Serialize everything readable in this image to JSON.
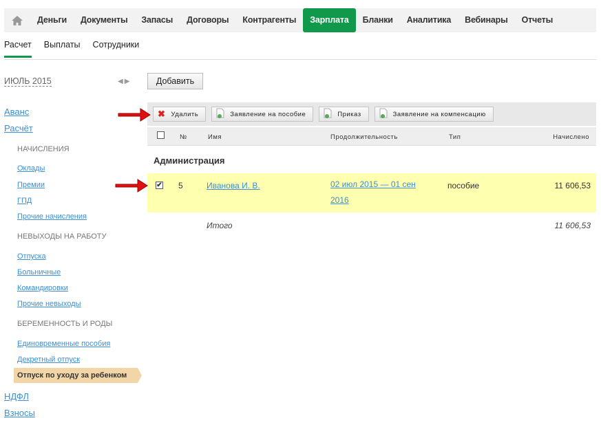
{
  "topnav": {
    "items": [
      "Деньги",
      "Документы",
      "Запасы",
      "Договоры",
      "Контрагенты",
      "Зарплата",
      "Бланки",
      "Аналитика",
      "Вебинары",
      "Отчеты"
    ],
    "active": "Зарплата",
    "accent": "#10994a"
  },
  "subnav": {
    "items": [
      "Расчет",
      "Выплаты",
      "Сотрудники"
    ]
  },
  "period": "ИЮЛЬ 2015",
  "add_label": "Добавить",
  "sidebar": {
    "avans": "Аванс",
    "raschet": "Расчёт",
    "h1": "НАЧИСЛЕНИЯ",
    "okl": "Оклады",
    "prem": "Премии",
    "gpd": "ГПД",
    "proch": "Прочие начисления",
    "h2": "НЕВЫХОДЫ НА РАБОТУ",
    "otp": "Отпуска",
    "bol": "Больничные",
    "kom": "Командировки",
    "prnev": "Прочие невыходы",
    "h3": "БЕРЕМЕННОСТЬ И РОДЫ",
    "edin": "Единовременные пособия",
    "dekr": "Декретный отпуск",
    "active": "Отпуск по уходу за ребенком",
    "ndfl": "НДФЛ",
    "vznosy": "Взносы"
  },
  "toolbar": {
    "delete": "Удалить",
    "benefit": "Заявление на пособие",
    "order": "Приказ",
    "compensation": "Заявление на компенсацию"
  },
  "table": {
    "headers": {
      "num": "№",
      "name": "Имя",
      "duration": "Продолжительность",
      "type": "Тип",
      "accrued": "Начислено"
    },
    "group": "Администрация",
    "row": {
      "checked": true,
      "num": "5",
      "name": "Иванова И. В.",
      "duration": "02 июл 2015 — 01 сен 2016",
      "type": "пособие",
      "accrued": "11 606,53"
    },
    "total_label": "Итого",
    "total_value": "11 606,53"
  }
}
